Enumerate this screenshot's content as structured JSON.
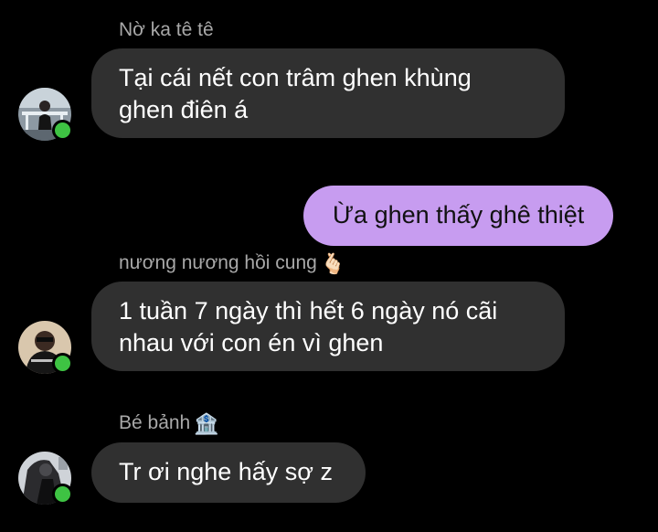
{
  "colors": {
    "background": "#000000",
    "incoming_bubble": "#303030",
    "outgoing_bubble": "#c79cf0",
    "sender_name": "#a8a8a8",
    "online_status": "#3ec343"
  },
  "messages": [
    {
      "direction": "incoming",
      "sender": "Nờ ka tê tê",
      "sender_emoji": "",
      "text": "Tại cái nết con trâm ghen khùng\nghen điên á",
      "avatar_icon": "avatar-photo",
      "online": true
    },
    {
      "direction": "outgoing",
      "text": "Ừa ghen thấy ghê thiệt"
    },
    {
      "direction": "incoming",
      "sender": "nương nương hồi cung",
      "sender_emoji": "🫰🏻",
      "text": "1 tuần 7 ngày thì hết 6 ngày nó cãi\nnhau với con én vì ghen",
      "avatar_icon": "avatar-photo",
      "online": true
    },
    {
      "direction": "incoming",
      "sender": "Bé bảnh",
      "sender_emoji": "🏦",
      "text": "Tr ơi nghe hấy sợ z",
      "avatar_icon": "avatar-photo",
      "online": true
    }
  ]
}
